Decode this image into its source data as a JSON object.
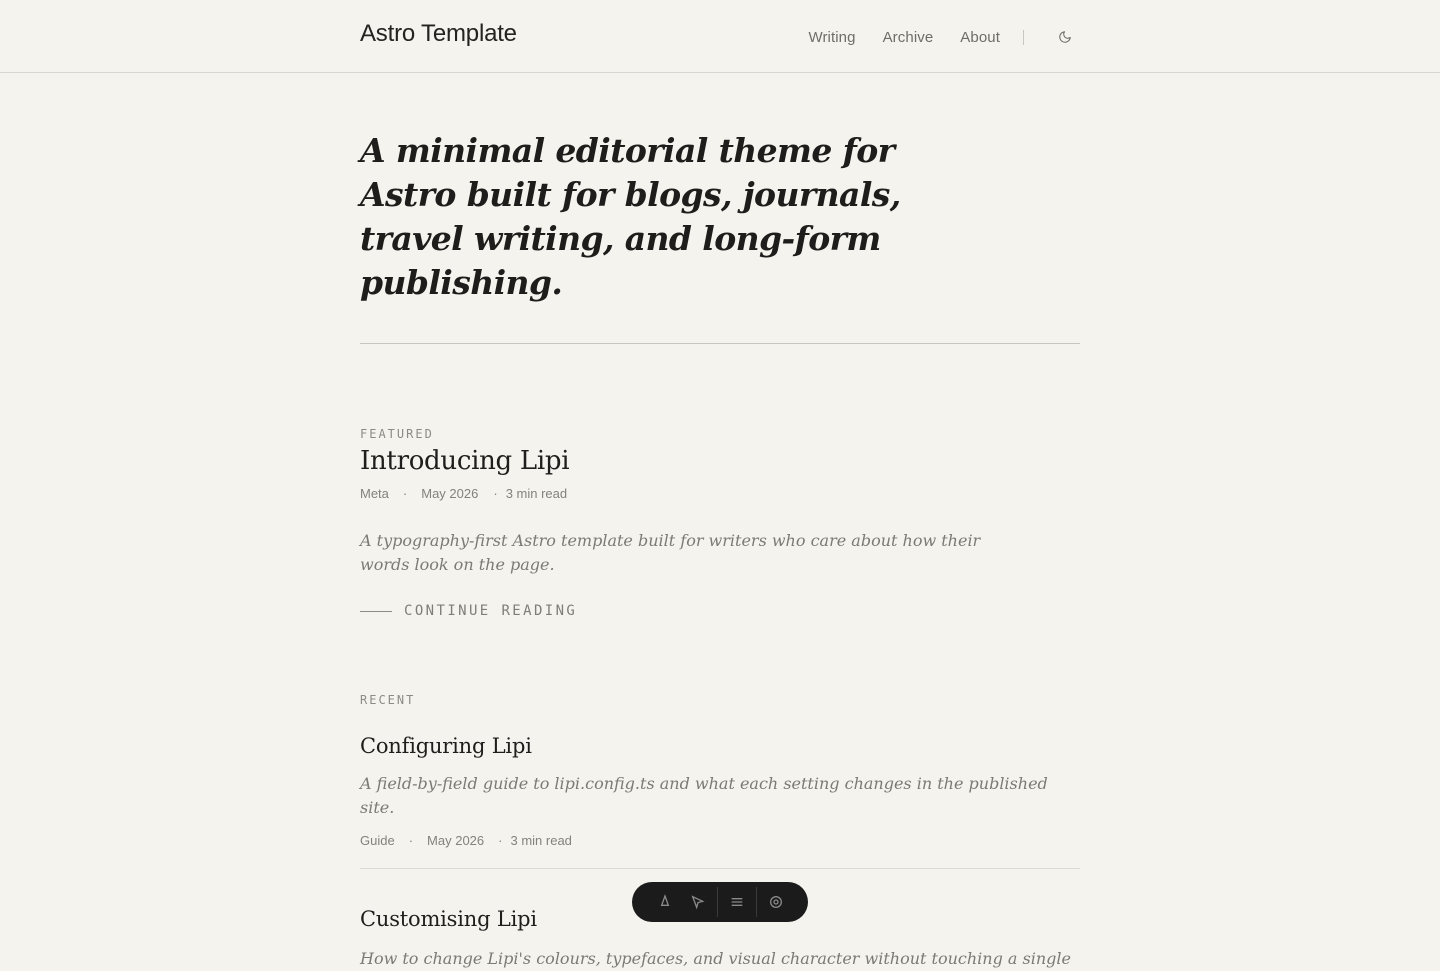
{
  "site": {
    "brand": "Astro Template",
    "nav": [
      {
        "label": "Writing"
      },
      {
        "label": "Archive"
      },
      {
        "label": "About"
      }
    ],
    "theme_toggle_icon": "moon-icon"
  },
  "hero": {
    "text": "A minimal editorial theme for Astro built for blogs, journals, travel writing, and long-form publishing."
  },
  "featured": {
    "label": "FEATURED",
    "title": "Introducing Lipi",
    "category": "Meta",
    "date": "May 2026",
    "read_time": "3 min read",
    "excerpt": "A typography-first Astro template built for writers who care about how their words look on the page.",
    "cta": "CONTINUE READING"
  },
  "recent": {
    "label": "RECENT",
    "posts": [
      {
        "title": "Configuring Lipi",
        "excerpt": "A field-by-field guide to lipi.config.ts and what each setting changes in the published site.",
        "category": "Guide",
        "date": "May 2026",
        "read_time": "3 min read"
      },
      {
        "title": "Customising Lipi",
        "excerpt": "How to change Lipi's colours, typefaces, and visual character without touching a single"
      }
    ]
  },
  "toolbar": {
    "icons": [
      "astro-icon",
      "inspect-icon",
      "menu-icon",
      "settings-icon"
    ]
  },
  "colors": {
    "background": "#f4f3ee",
    "text": "#1f1e1c",
    "muted": "#7c7a73"
  }
}
